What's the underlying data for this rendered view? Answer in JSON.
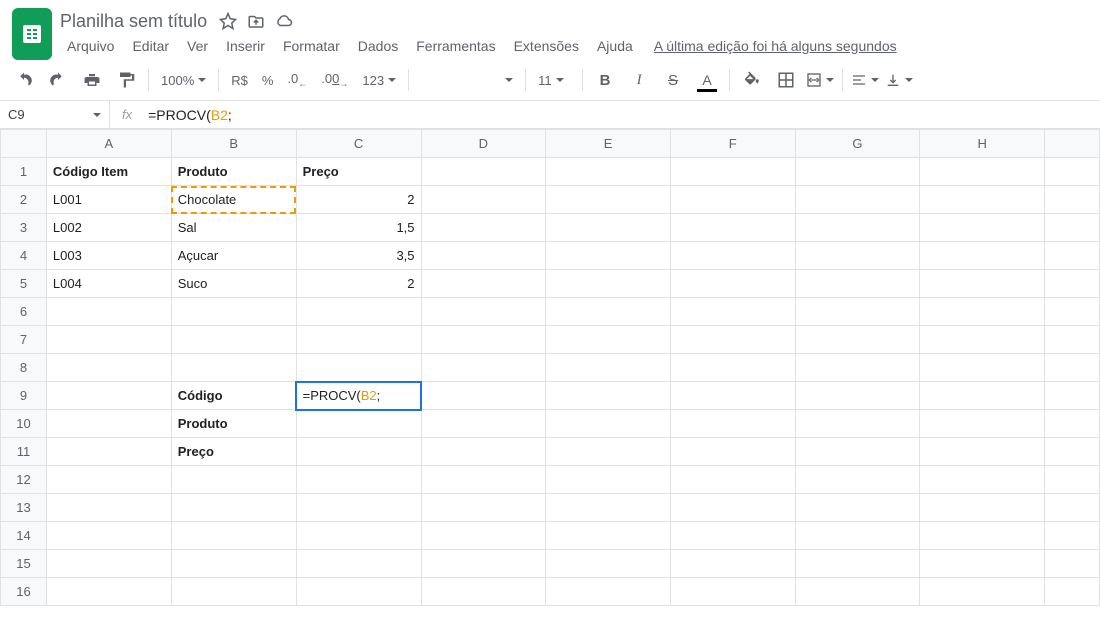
{
  "doc": {
    "title": "Planilha sem título"
  },
  "menus": {
    "arquivo": "Arquivo",
    "editar": "Editar",
    "ver": "Ver",
    "inserir": "Inserir",
    "formatar": "Formatar",
    "dados": "Dados",
    "ferramentas": "Ferramentas",
    "extensoes": "Extensões",
    "ajuda": "Ajuda",
    "last_edit": "A última edição foi há alguns segundos"
  },
  "toolbar": {
    "zoom": "100%",
    "currency": "R$",
    "pct": "%",
    "dec_dec": ".0",
    "inc_dec": ".00",
    "fmt123": "123",
    "font_size": "11"
  },
  "formula_bar": {
    "cell_ref": "C9",
    "prefix": "=PROCV(",
    "ref": "B2",
    "suffix": ";"
  },
  "columns": [
    "A",
    "B",
    "C",
    "D",
    "E",
    "F",
    "G",
    "H",
    ""
  ],
  "rows": [
    "1",
    "2",
    "3",
    "4",
    "5",
    "6",
    "7",
    "8",
    "9",
    "10",
    "11",
    "12",
    "13",
    "14",
    "15",
    "16"
  ],
  "cells": {
    "A1": {
      "v": "Código Item",
      "bold": true
    },
    "B1": {
      "v": "Produto",
      "bold": true
    },
    "C1": {
      "v": "Preço",
      "bold": true
    },
    "A2": {
      "v": "L001"
    },
    "B2": {
      "v": "Chocolate",
      "copied": true
    },
    "C2": {
      "v": "2",
      "num": true
    },
    "A3": {
      "v": "L002"
    },
    "B3": {
      "v": "Sal"
    },
    "C3": {
      "v": "1,5",
      "num": true
    },
    "A4": {
      "v": "L003"
    },
    "B4": {
      "v": "Açucar"
    },
    "C4": {
      "v": "3,5",
      "num": true
    },
    "A5": {
      "v": "L004"
    },
    "B5": {
      "v": "Suco"
    },
    "C5": {
      "v": "2",
      "num": true
    },
    "B9": {
      "v": "Código",
      "bold": true
    },
    "B10": {
      "v": "Produto",
      "bold": true
    },
    "B11": {
      "v": "Preço",
      "bold": true
    }
  },
  "editing_cell": "C9"
}
